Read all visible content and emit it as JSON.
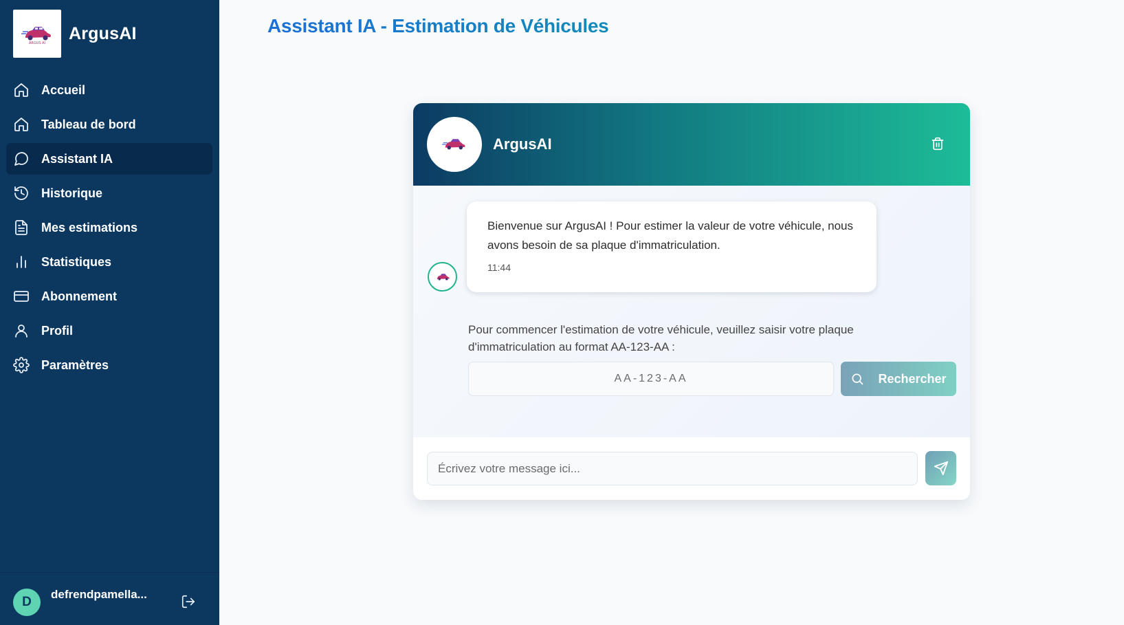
{
  "app": {
    "name": "ArgusAI"
  },
  "sidebar": {
    "items": [
      {
        "label": "Accueil",
        "icon": "home-icon",
        "active": false
      },
      {
        "label": "Tableau de bord",
        "icon": "home-icon",
        "active": false
      },
      {
        "label": "Assistant IA",
        "icon": "chat-bubble-icon",
        "active": true
      },
      {
        "label": "Historique",
        "icon": "history-icon",
        "active": false
      },
      {
        "label": "Mes estimations",
        "icon": "document-icon",
        "active": false
      },
      {
        "label": "Statistiques",
        "icon": "bar-chart-icon",
        "active": false
      },
      {
        "label": "Abonnement",
        "icon": "credit-card-icon",
        "active": false
      },
      {
        "label": "Profil",
        "icon": "user-icon",
        "active": false
      },
      {
        "label": "Paramètres",
        "icon": "gear-icon",
        "active": false
      }
    ],
    "user": {
      "initial": "D",
      "name": "defrendpamella..."
    }
  },
  "main": {
    "title": "Assistant IA - Estimation de Véhicules"
  },
  "chat": {
    "header_title": "ArgusAI",
    "message": {
      "text": "Bienvenue sur ArgusAI ! Pour estimer la valeur de votre véhicule, nous avons besoin de sa plaque d'immatriculation.",
      "time": "11:44"
    },
    "plate_prompt": "Pour commencer l'estimation de votre véhicule, veuillez saisir votre plaque d'immatriculation au format AA-123-AA :",
    "plate_placeholder": "AA-123-AA",
    "search_label": "Rechercher",
    "message_placeholder": "Écrivez votre message ici..."
  },
  "colors": {
    "sidebar_bg": "#0c3860",
    "sidebar_active": "#082a4c",
    "accent_teal": "#1dbc98",
    "title_blue": "#1d6fd6"
  }
}
